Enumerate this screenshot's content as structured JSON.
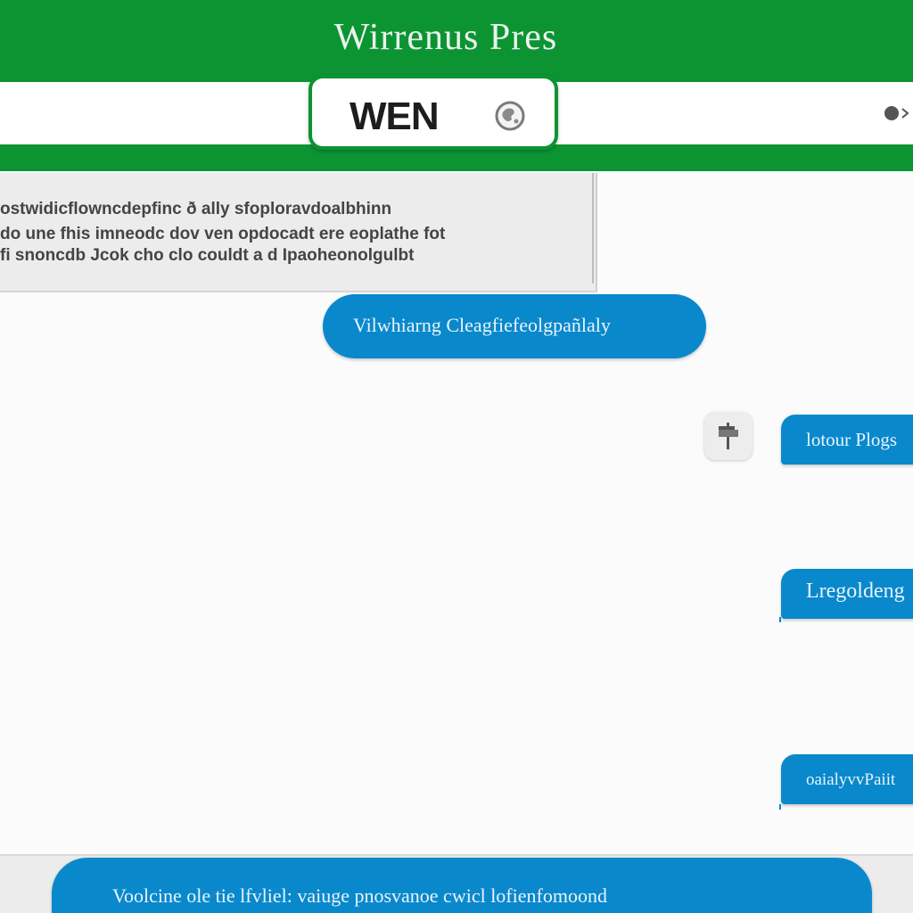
{
  "header": {
    "app_title": "Wirrenus Pres",
    "brand": "WEN"
  },
  "incoming": {
    "lines": [
      "ostwidicflowncdepfinc  ð ally  sfoploravdoalbhinn",
      "do une fhis imneodc dov ven opdocadt ere eoplathe fot",
      "fi  snoncdb Jcok  cho clo couldt  a  d  Ipaoheonolgulbt"
    ]
  },
  "messages": {
    "center_bubble": "Vilwhiarng  Cleagfiefeolgpañlaly",
    "right_bubbles": [
      "lotour  Plogs",
      "Lregoldeng",
      "oaialyvvPaiit"
    ]
  },
  "composer": {
    "text": "Voolcine ole tie lfvliel: vaiuge pnosvanoe cwicl lofienfomoond"
  },
  "colors": {
    "header_green": "#0c9433",
    "bubble_blue": "#0a88cc",
    "panel_gray": "#ececec"
  }
}
